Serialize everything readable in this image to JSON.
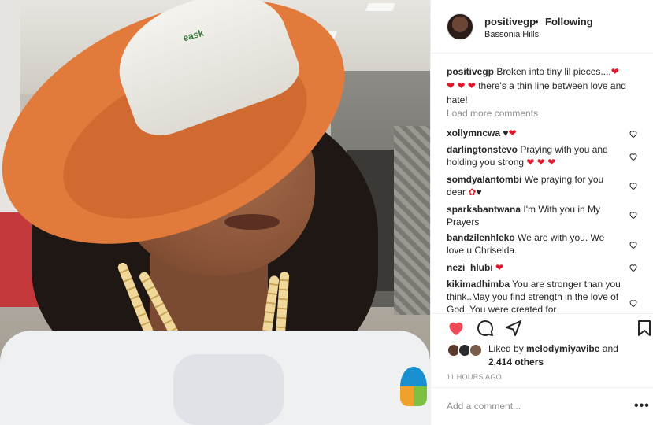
{
  "post_header": {
    "username": "positivegp",
    "separator": "•",
    "follow_status": "Following",
    "location": "Bassonia Hills"
  },
  "photo": {
    "hat_brand_text": "eask"
  },
  "caption": {
    "username": "positivegp",
    "text_part1": "Broken into tiny lil pieces....",
    "text_part2": "there's a thin line between love and hate!"
  },
  "load_more_label": "Load more comments",
  "comments": [
    {
      "username": "xollymncwa",
      "text": ""
    },
    {
      "username": "darlingtonstevo",
      "text": "Praying with you and holding you strong"
    },
    {
      "username": "somdyalantombi",
      "text": "We praying for you dear"
    },
    {
      "username": "sparksbantwana",
      "text": "I'm With you in My Prayers"
    },
    {
      "username": "bandzilenhleko",
      "text": "We are with you. We love u Chriselda."
    },
    {
      "username": "nezi_hlubi",
      "text": ""
    },
    {
      "username": "kikimadhimba",
      "text": "You are stronger than you think..May you find strength in the love of God. You were created for"
    }
  ],
  "likes": {
    "prefix": "Liked by",
    "user": "melodymiyavibe",
    "and": "and",
    "others": "2,414 others"
  },
  "timestamp": "11 HOURS AGO",
  "add_comment": {
    "placeholder": "Add a comment..."
  },
  "more_label": "•••",
  "icons": {
    "like": "heart-icon",
    "comment": "comment-bubble-icon",
    "share": "share-arrow-icon",
    "save": "bookmark-icon"
  },
  "colors": {
    "like_red": "#ed4956",
    "text": "#262626",
    "muted": "#8e8e8e",
    "divider": "#efefef"
  }
}
